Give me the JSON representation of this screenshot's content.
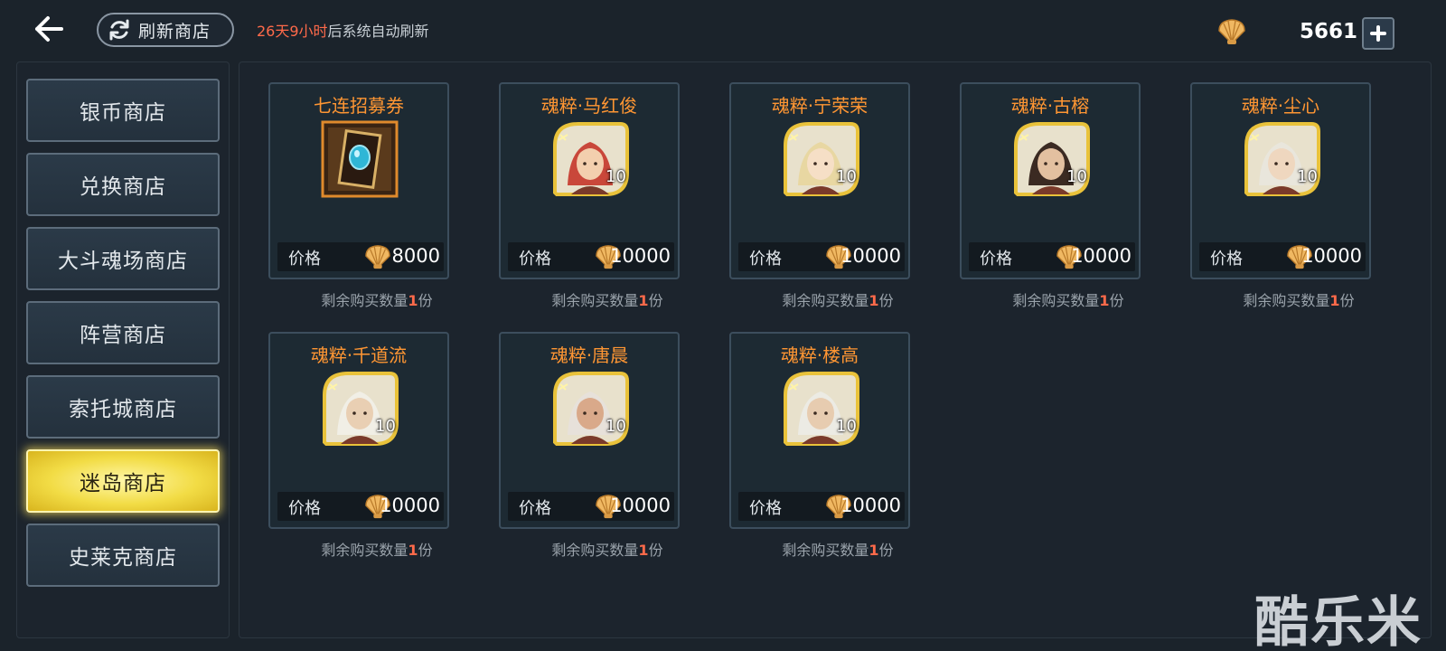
{
  "header": {
    "refresh_label": "刷新商店",
    "refresh_time": "26天9小时",
    "refresh_suffix": "后系统自动刷新",
    "currency_icon": "shell-coin-icon",
    "currency_amount": "5661"
  },
  "sidebar": {
    "items": [
      {
        "label": "银币商店"
      },
      {
        "label": "兑换商店"
      },
      {
        "label": "大斗魂场商店"
      },
      {
        "label": "阵营商店"
      },
      {
        "label": "索托城商店"
      },
      {
        "label": "迷岛商店",
        "active": true
      },
      {
        "label": "史莱克商店"
      }
    ]
  },
  "shop": {
    "price_label": "价格",
    "remain_prefix": "剩余购买数量",
    "remain_suffix": "份",
    "items": [
      {
        "title": "七连招募券",
        "type": "ticket",
        "price": "8000",
        "remain": "1"
      },
      {
        "title": "魂粹·马红俊",
        "type": "soul",
        "count": "10",
        "price": "10000",
        "remain": "1",
        "hair": "#c9473a",
        "skin": "#f3cfae"
      },
      {
        "title": "魂粹·宁荣荣",
        "type": "soul",
        "count": "10",
        "price": "10000",
        "remain": "1",
        "hair": "#e8d7a2",
        "skin": "#f6dfc6"
      },
      {
        "title": "魂粹·古榕",
        "type": "soul",
        "count": "10",
        "price": "10000",
        "remain": "1",
        "hair": "#3b2a22",
        "skin": "#e3c0a0"
      },
      {
        "title": "魂粹·尘心",
        "type": "soul",
        "count": "10",
        "price": "10000",
        "remain": "1",
        "hair": "#e9e6dc",
        "skin": "#efd7bf"
      },
      {
        "title": "魂粹·千道流",
        "type": "soul",
        "count": "10",
        "price": "10000",
        "remain": "1",
        "hair": "#f1efe6",
        "skin": "#e9cfb3"
      },
      {
        "title": "魂粹·唐晨",
        "type": "soul",
        "count": "10",
        "price": "10000",
        "remain": "1",
        "hair": "#e7e1da",
        "skin": "#d9a98a"
      },
      {
        "title": "魂粹·楼高",
        "type": "soul",
        "count": "10",
        "price": "10000",
        "remain": "1",
        "hair": "#ecebe4",
        "skin": "#e7ccb0"
      }
    ]
  },
  "watermark": "酷乐米"
}
